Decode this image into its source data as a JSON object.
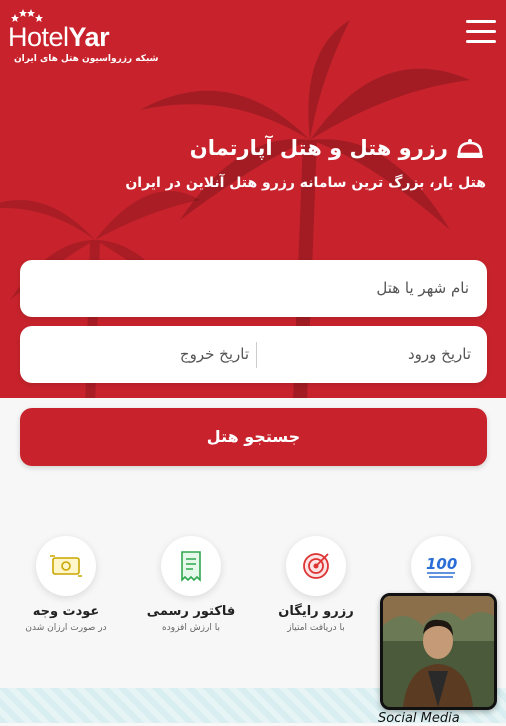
{
  "logo": {
    "name_regular": "Hotel",
    "name_bold": "Yar",
    "tagline": "شبکه رزرواسیون هتل های ایران"
  },
  "header": {
    "menu_icon": "hamburger-menu-icon"
  },
  "hero": {
    "title": "رزرو هتل و هتل آپارتمان",
    "title_icon": "cloche-icon",
    "subtitle": "هتل یار، بزرگ ترین سامانه رزرو هتل آنلاین در ایران"
  },
  "search": {
    "city_placeholder": "نام شهر یا هتل",
    "checkin_placeholder": "تاریخ ورود",
    "checkout_placeholder": "تاریخ خروج",
    "button_label": "جستجو هتل"
  },
  "features": [
    {
      "icon": "money-refund-icon",
      "title": "عودت وجه",
      "subtitle": "در صورت ارزان شدن"
    },
    {
      "icon": "receipt-icon",
      "title": "فاکتور رسمی",
      "subtitle": "با ارزش افزوده"
    },
    {
      "icon": "target-icon",
      "title": "رزرو رایگان",
      "subtitle": "با دریافت امتیاز"
    },
    {
      "icon": "hundred-points-icon",
      "title": "",
      "subtitle": ""
    }
  ],
  "video_widget": {
    "caption": "Social Media"
  },
  "colors": {
    "brand_red": "#c8232c",
    "background": "#f7f7f7"
  }
}
